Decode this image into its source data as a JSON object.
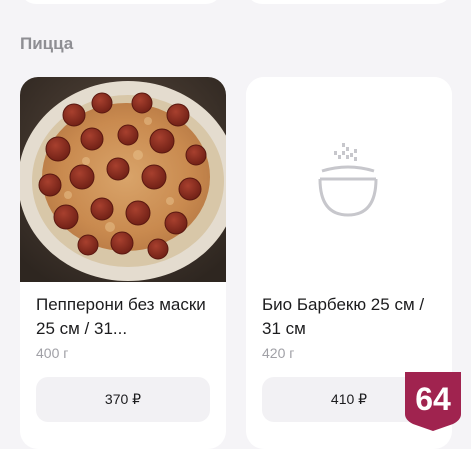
{
  "section": {
    "title": "Пицца"
  },
  "products": [
    {
      "name": "Пепперони без маски 25 см / 31...",
      "weight": "400 г",
      "price": "370 ₽"
    },
    {
      "name": "Био Барбекю 25 см / 31 см",
      "weight": "420 г",
      "price": "410 ₽"
    }
  ],
  "badge": {
    "text": "64",
    "color": "#a0234f"
  },
  "colors": {
    "background": "#f5f4f7",
    "card": "#ffffff",
    "button": "#f2f1f4",
    "muted_text": "#8e8e93"
  }
}
